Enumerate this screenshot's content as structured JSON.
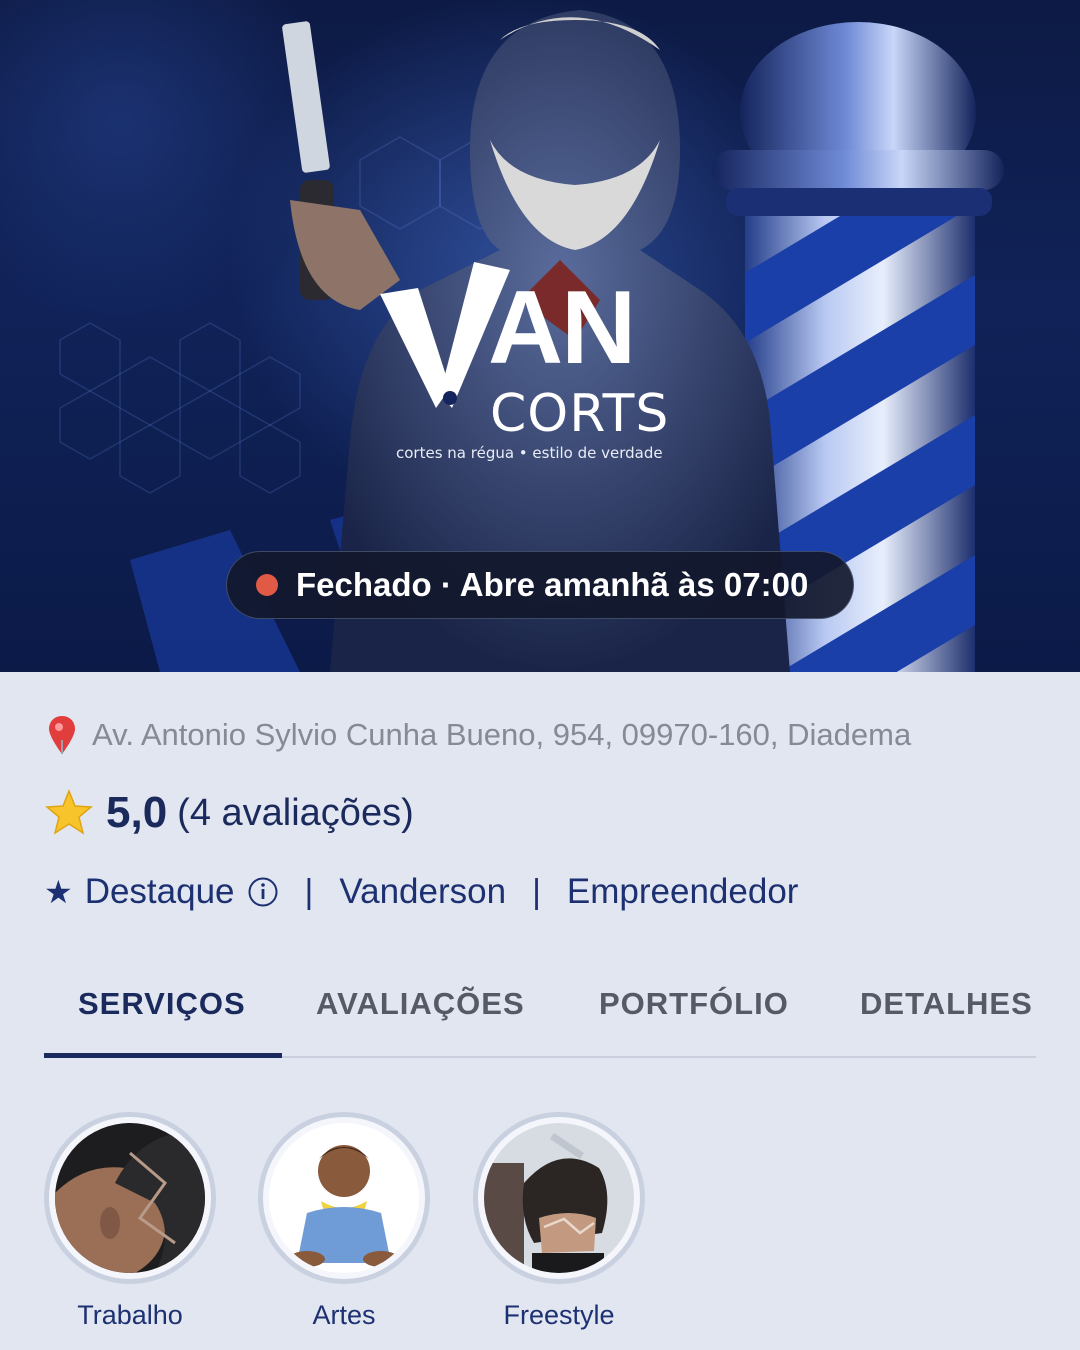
{
  "hero": {
    "brand_main": "AN",
    "brand_sub": "CORTS",
    "brand_tagline": "cortes na régua • estilo de verdade",
    "status_text": "Fechado · Abre amanhã às 07:00",
    "status_color": "#e05a45"
  },
  "business": {
    "address": "Av. Antonio Sylvio Cunha Bueno, 954, 09970-160, Diadema",
    "rating_value": "5,0",
    "rating_count": "(4 avaliações)",
    "badge_label": "Destaque",
    "owner": "Vanderson",
    "role": "Empreendedor"
  },
  "tabs": [
    {
      "label": "SERVIÇOS",
      "active": true
    },
    {
      "label": "AVALIAÇÕES",
      "active": false
    },
    {
      "label": "PORTFÓLIO",
      "active": false
    },
    {
      "label": "DETALHES",
      "active": false
    }
  ],
  "categories": [
    {
      "label": "Trabalho",
      "icon": "haircut-design-photo"
    },
    {
      "label": "Artes",
      "icon": "baby-photo"
    },
    {
      "label": "Freestyle",
      "icon": "haircut-freestyle-photo"
    }
  ],
  "colors": {
    "primary": "#1b2a5c",
    "link": "#1d3172",
    "background": "#e1e6f0",
    "muted": "#858a96"
  },
  "icons": {
    "address": "location-pin-icon",
    "rating": "star-icon",
    "badge": "star-small-icon",
    "info": "info-icon"
  }
}
